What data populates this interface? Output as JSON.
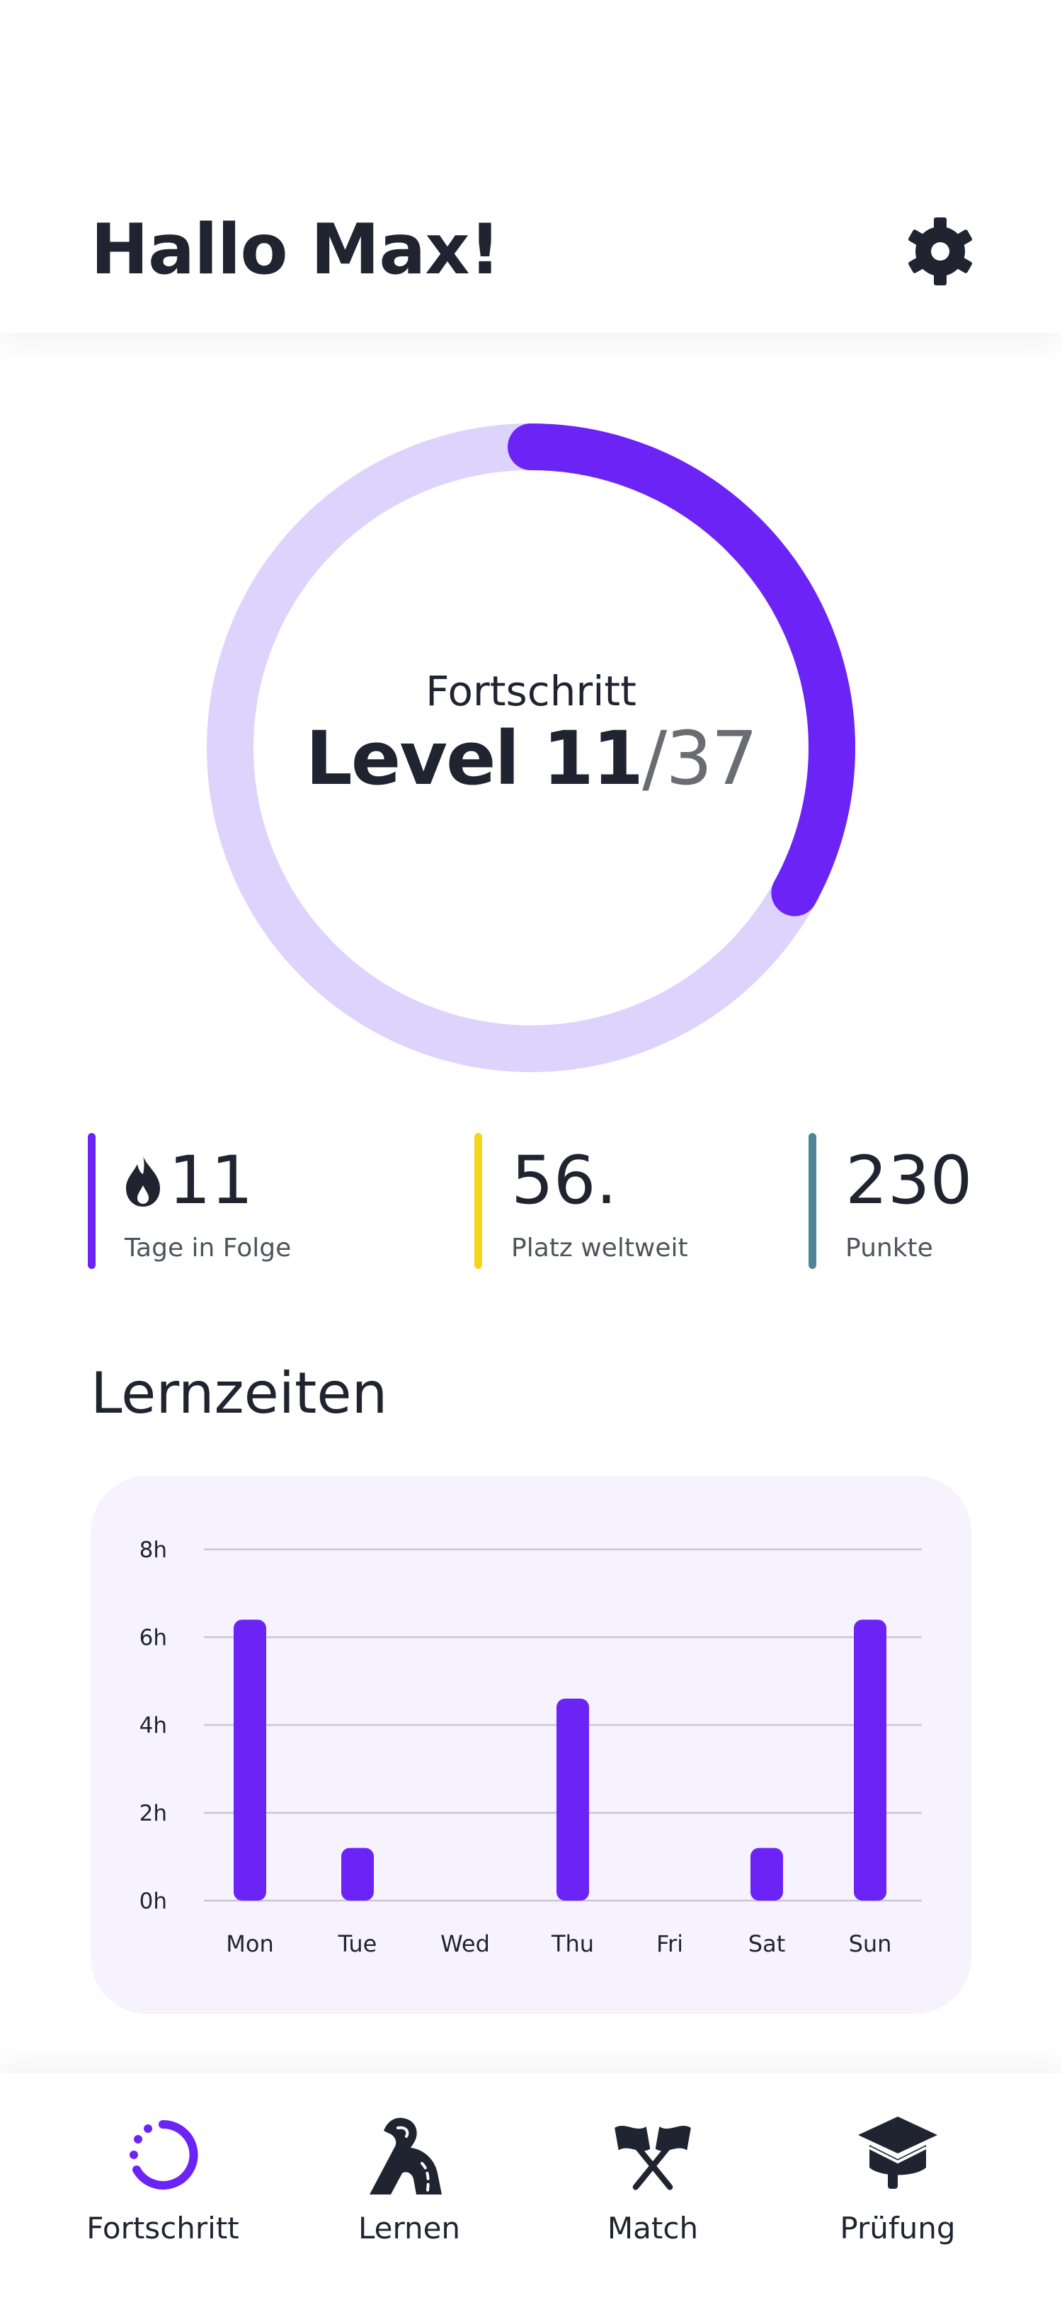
{
  "header": {
    "greeting": "Hallo Max!",
    "settings_icon": "gear-icon"
  },
  "progress": {
    "label": "Fortschritt",
    "level_prefix": "Level 11",
    "level_total": "/37",
    "current_level": 11,
    "max_level": 37,
    "ring_fill_fraction": 0.33,
    "colors": {
      "ring_track": "#ddd3fd",
      "ring_fill": "#6c24f6"
    }
  },
  "stats": [
    {
      "value": "11",
      "caption": "Tage in Folge",
      "icon": "flame-icon",
      "color": "#6c24f6"
    },
    {
      "value": "56.",
      "caption": "Platz weltweit",
      "icon": "",
      "color": "#f5d51c"
    },
    {
      "value": "230",
      "caption": "Punkte",
      "icon": "",
      "color": "#4f8697"
    }
  ],
  "learning_times": {
    "title": "Lernzeiten"
  },
  "chart_data": {
    "type": "bar",
    "title": "Lernzeiten",
    "categories": [
      "Mon",
      "Tue",
      "Wed",
      "Thu",
      "Fri",
      "Sat",
      "Sun"
    ],
    "values": [
      6.4,
      1.2,
      0,
      4.6,
      0,
      1.2,
      6.4
    ],
    "ylim": [
      0,
      8
    ],
    "yticks": [
      0,
      2,
      4,
      6,
      8
    ],
    "ytick_labels": [
      "0h",
      "2h",
      "4h",
      "6h",
      "8h"
    ],
    "grid": true,
    "bar_color": "#6c24f6",
    "xlabel": "",
    "ylabel": ""
  },
  "nav": {
    "items": [
      {
        "label": "Fortschritt",
        "icon": "progress-ring-icon",
        "active": true
      },
      {
        "label": "Lernen",
        "icon": "road-icon",
        "active": false
      },
      {
        "label": "Match",
        "icon": "crossed-flags-icon",
        "active": false
      },
      {
        "label": "Prüfung",
        "icon": "graduation-cap-icon",
        "active": false
      }
    ],
    "active_color": "#6c24f6",
    "icon_color": "#1f2430"
  }
}
